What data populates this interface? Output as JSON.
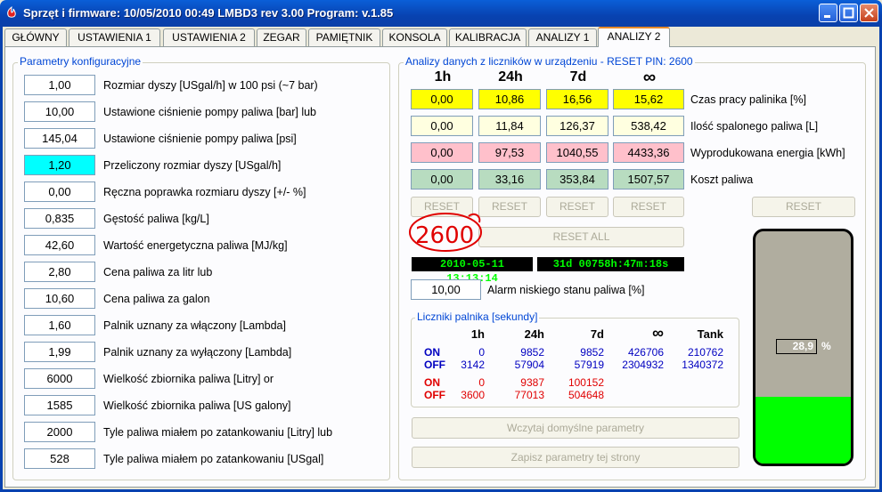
{
  "window": {
    "title": "Sprzęt i firmware: 10/05/2010 00:49   LMBD3 rev 3.00   Program: v.1.85",
    "min_icon": "minimize-icon",
    "max_icon": "maximize-icon",
    "close_icon": "close-icon"
  },
  "tabs": [
    {
      "label": "GŁÓWNY"
    },
    {
      "label": "USTAWIENIA 1"
    },
    {
      "label": "USTAWIENIA 2"
    },
    {
      "label": "ZEGAR"
    },
    {
      "label": "PAMIĘTNIK"
    },
    {
      "label": "KONSOLA"
    },
    {
      "label": "KALIBRACJA"
    },
    {
      "label": "ANALIZY 1"
    },
    {
      "label": "ANALIZY 2",
      "active": true
    }
  ],
  "config": {
    "title": "Parametry konfiguracyjne",
    "rows": [
      {
        "value": "1,00",
        "label": "Rozmiar dyszy [USgal/h] w 100 psi (~7 bar)"
      },
      {
        "value": "10,00",
        "label": "Ustawione ciśnienie pompy paliwa [bar] lub"
      },
      {
        "value": "145,04",
        "label": "Ustawione ciśnienie pompy paliwa [psi]"
      },
      {
        "value": "1,20",
        "label": "Przeliczony rozmiar dyszy [USgal/h]",
        "highlight": "#00ffff"
      },
      {
        "value": "0,00",
        "label": "Ręczna poprawka rozmiaru dyszy [+/- %]"
      },
      {
        "value": "0,835",
        "label": "Gęstość paliwa [kg/L]"
      },
      {
        "value": "42,60",
        "label": "Wartość energetyczna paliwa [MJ/kg]"
      },
      {
        "value": "2,80",
        "label": "Cena paliwa za litr lub"
      },
      {
        "value": "10,60",
        "label": "Cena paliwa za galon"
      },
      {
        "value": "1,60",
        "label": "Palnik uznany za włączony [Lambda]"
      },
      {
        "value": "1,99",
        "label": "Palnik uznany za wyłączony [Lambda]"
      },
      {
        "value": "6000",
        "label": "Wielkość zbiornika paliwa [Litry] or"
      },
      {
        "value": "1585",
        "label": "Wielkość zbiornika paliwa [US galony]"
      },
      {
        "value": "2000",
        "label": "Tyle paliwa miałem po zatankowaniu [Litry] lub"
      },
      {
        "value": "528",
        "label": "Tyle paliwa miałem po zatankowaniu [USgal]"
      }
    ]
  },
  "analysis": {
    "title": "Analizy danych z liczników w urządzeniu - RESET PIN: 2600",
    "headers": [
      "1h",
      "24h",
      "7d",
      "∞"
    ],
    "rows": [
      {
        "values": [
          "0,00",
          "10,86",
          "16,56",
          "15,62"
        ],
        "label": "Czas pracy palinika [%]",
        "color": "yellow"
      },
      {
        "values": [
          "0,00",
          "11,84",
          "126,37",
          "538,42"
        ],
        "label": "Ilość spalonego paliwa [L]",
        "color": "lyellow"
      },
      {
        "values": [
          "0,00",
          "97,53",
          "1040,55",
          "4433,36"
        ],
        "label": "Wyprodukowana energia [kWh]",
        "color": "pink"
      },
      {
        "values": [
          "0,00",
          "33,16",
          "353,84",
          "1507,57"
        ],
        "label": "Koszt paliwa",
        "color": "green"
      }
    ],
    "reset_label": "RESET",
    "reset_all_label": "RESET ALL",
    "pin_annotation": "2600",
    "clock": "2010-05-11 13:13:14",
    "uptime": "31d  00758h:47m:18s",
    "alarm_value": "10,00",
    "alarm_label": "Alarm niskiego stanu paliwa [%]"
  },
  "counters": {
    "title": "Liczniki palnika [sekundy]",
    "headers": [
      "1h",
      "24h",
      "7d",
      "∞",
      "Tank"
    ],
    "rows": [
      {
        "label": "ON",
        "values": [
          "0",
          "9852",
          "9852",
          "426706",
          "210762"
        ],
        "color": "#0000c0"
      },
      {
        "label": "OFF",
        "values": [
          "3142",
          "57904",
          "57919",
          "2304932",
          "1340372"
        ],
        "color": "#0000c0"
      },
      {
        "label": "ON",
        "values": [
          "0",
          "9387",
          "100152",
          "",
          ""
        ],
        "color": "#e00000"
      },
      {
        "label": "OFF",
        "values": [
          "3600",
          "77013",
          "504648",
          "",
          ""
        ],
        "color": "#e00000"
      }
    ]
  },
  "buttons": {
    "load_defaults": "Wczytaj domyślne parametry",
    "save_page": "Zapisz parametry tej strony"
  },
  "tank": {
    "level_text": "28,9",
    "percent_sign": "%",
    "fill_fraction": 0.289
  },
  "colors": {
    "title_bar": "#0842b0",
    "cyan_highlight": "#00ffff",
    "yellow": "#ffff00",
    "pink": "#ffc0cb",
    "green": "#b8dcc0",
    "tank_fill": "#00ff00",
    "annotation_red": "#e00000"
  }
}
